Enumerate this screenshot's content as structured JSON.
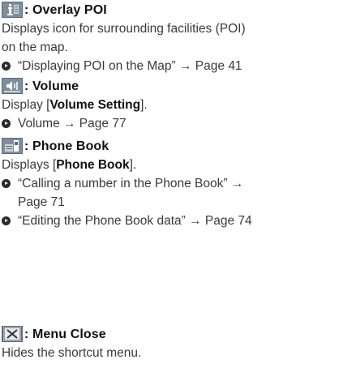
{
  "overlay_poi": {
    "title": ": Overlay POI",
    "desc_line1": "Displays icon for surrounding facilities (POI)",
    "desc_line2": "on the map.",
    "ref": "“Displaying POI on the Map” → Page 41"
  },
  "volume": {
    "title": ": Volume",
    "desc_prefix": "Display [",
    "desc_bold": "Volume Setting",
    "desc_suffix": "].",
    "ref": "Volume → Page 77"
  },
  "phone_book": {
    "title": ": Phone Book",
    "desc_prefix": "Displays [",
    "desc_bold": "Phone Book",
    "desc_suffix": "].",
    "ref1_line1": "“Calling a number in the Phone Book” →",
    "ref1_line2": "Page 71",
    "ref2": "“Editing the Phone Book data” → Page 74"
  },
  "menu_close": {
    "title": ": Menu Close",
    "desc": "Hides the shortcut menu."
  },
  "icons": {
    "overlay_poi": "info-poi-icon",
    "volume": "volume-icon",
    "phone_book": "phone-book-icon",
    "menu_close": "menu-close-icon"
  }
}
